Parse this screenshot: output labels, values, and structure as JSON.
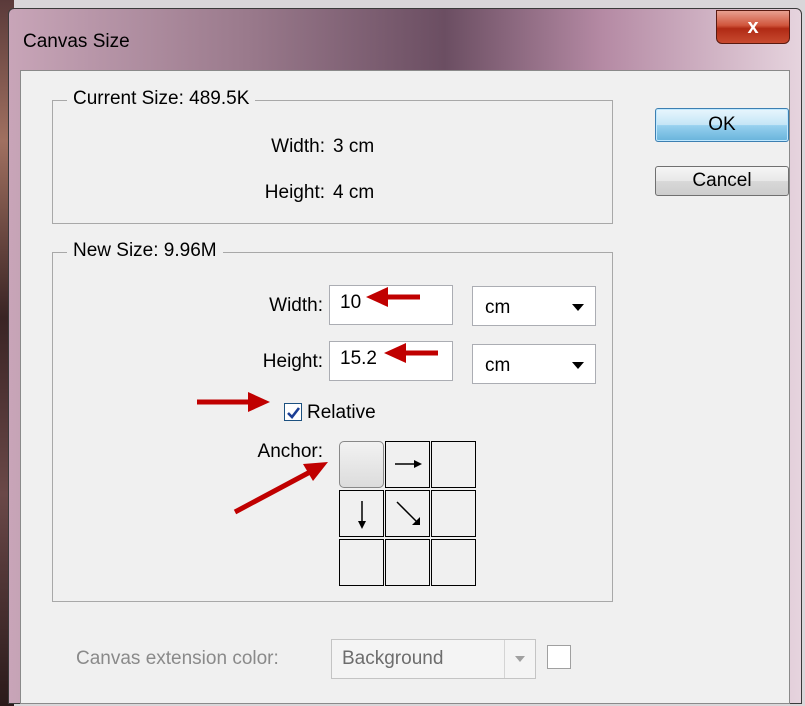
{
  "window": {
    "title": "Canvas Size",
    "close_label": "x"
  },
  "current_size": {
    "legend": "Current Size: 489.5K",
    "width_label": "Width:",
    "width_value": "3 cm",
    "height_label": "Height:",
    "height_value": "4 cm"
  },
  "new_size": {
    "legend": "New Size: 9.96M",
    "width_label": "Width:",
    "width_value": "10",
    "width_unit": "cm",
    "height_label": "Height:",
    "height_value": "15.2",
    "height_unit": "cm",
    "relative_label": "Relative",
    "relative_checked": true,
    "anchor_label": "Anchor:",
    "anchor_selected": "center"
  },
  "buttons": {
    "ok": "OK",
    "cancel": "Cancel"
  },
  "extension": {
    "label": "Canvas extension color:",
    "value": "Background",
    "swatch_color": "#ffffff"
  },
  "colors": {
    "annotation_arrow": "#c00000",
    "ok_button": "#68b3db"
  },
  "icons": [
    "close-icon",
    "checkmark-icon",
    "arrow-right-icon",
    "arrow-down-icon",
    "arrow-down-right-icon",
    "chevron-down-icon"
  ]
}
